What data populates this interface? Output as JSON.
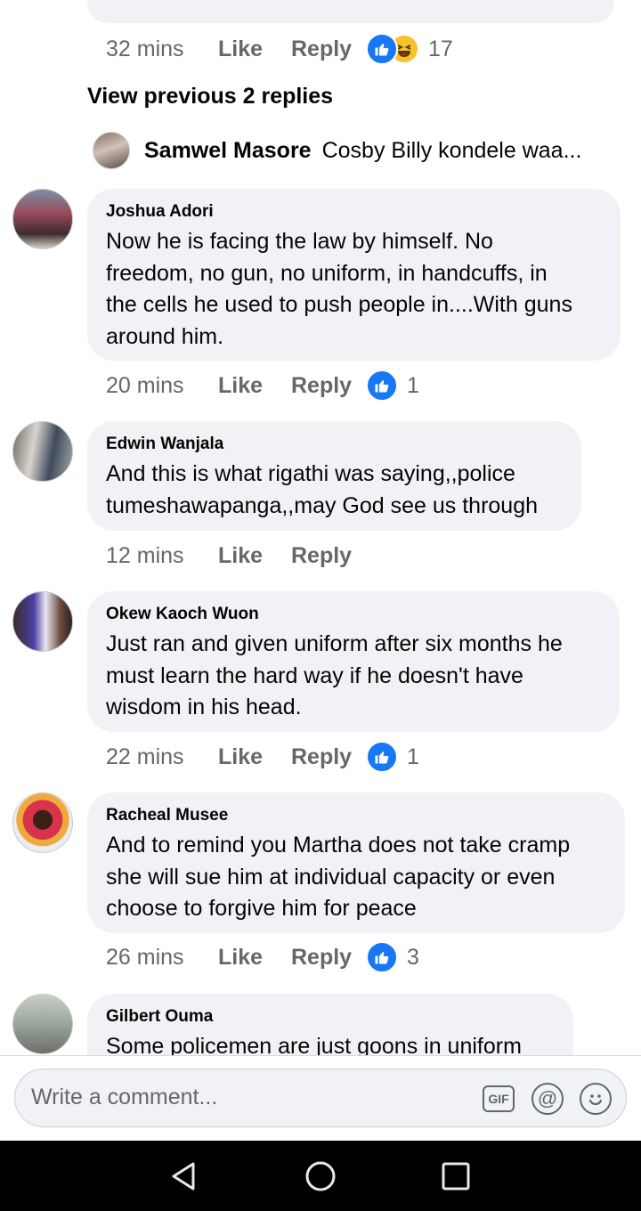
{
  "top_reply": {
    "time": "32 mins",
    "like": "Like",
    "reply": "Reply",
    "react_count": "17"
  },
  "view_previous": "View previous 2 replies",
  "nested_reply": {
    "name": "Samwel Masore",
    "text": "Cosby Billy kondele waa..."
  },
  "comments": [
    {
      "name": "Joshua Adori",
      "lines": [
        "Now he is facing the law by himself. No",
        "freedom, no gun, no uniform, in handcuffs, in",
        "the cells he used to push people in....With guns",
        "around him."
      ],
      "time": "20 mins",
      "like": "Like",
      "reply": "Reply",
      "react_count": "1"
    },
    {
      "name": "Edwin Wanjala",
      "lines": [
        "And this is what rigathi was saying,,police",
        "tumeshawapanga,,may God see us through"
      ],
      "time": "12 mins",
      "like": "Like",
      "reply": "Reply",
      "react_count": ""
    },
    {
      "name": "Okew Kaoch Wuon",
      "lines": [
        "Just ran and given uniform after six months he",
        "must learn the hard way if he doesn't have",
        "wisdom in his head."
      ],
      "time": "22 mins",
      "like": "Like",
      "reply": "Reply",
      "react_count": "1"
    },
    {
      "name": "Racheal Musee",
      "lines": [
        "And to remind you Martha does not take cramp",
        "she will sue him at individual capacity or even",
        "choose to forgive him for peace"
      ],
      "time": "26 mins",
      "like": "Like",
      "reply": "Reply",
      "react_count": "3"
    },
    {
      "name": "Gilbert Ouma",
      "lines": [
        "Some policemen are just goons in uniform"
      ]
    }
  ],
  "composer": {
    "placeholder": "Write a comment...",
    "gif_label": "GIF",
    "at_symbol": "@"
  },
  "icons": {
    "like": "thumbs-up-icon",
    "haha": "laughing-emoji-icon",
    "back": "back-triangle-icon",
    "home": "home-circle-icon",
    "recents": "recents-square-icon"
  },
  "colors": {
    "accent": "#1877f2",
    "bubble": "#f0f2f5",
    "meta": "#65676b"
  }
}
